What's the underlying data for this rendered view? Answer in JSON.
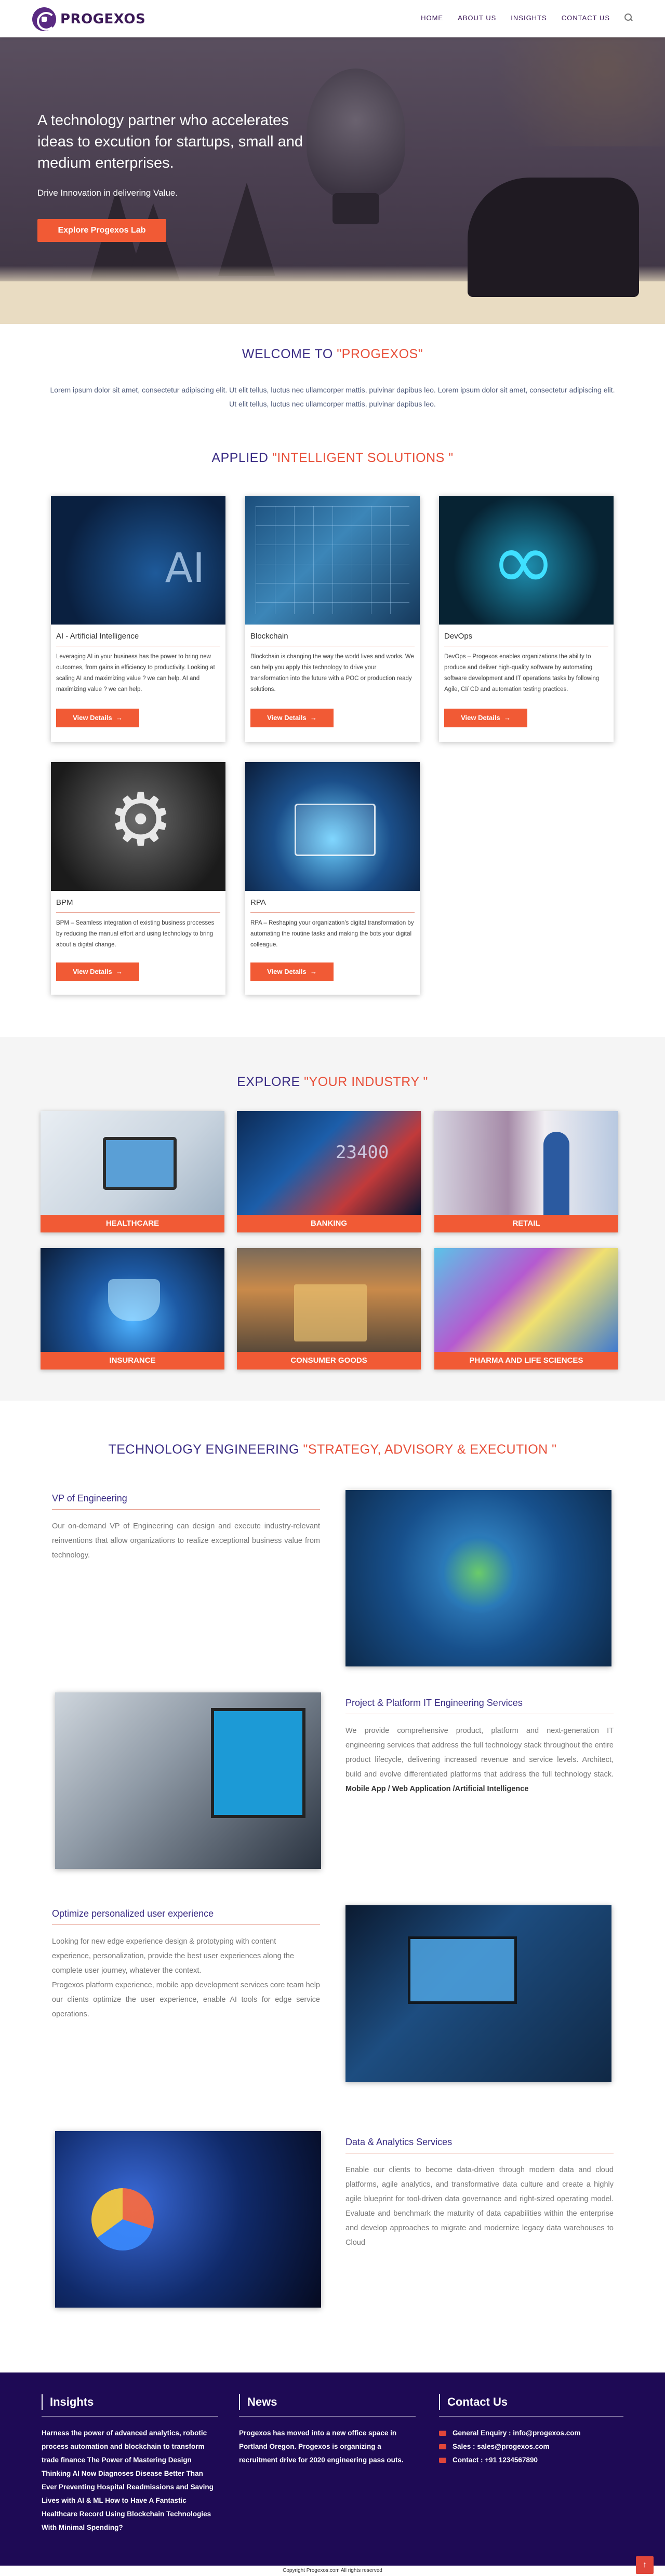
{
  "header": {
    "logo_text": "PROGEXOS",
    "nav": [
      "HOME",
      "ABOUT US",
      "INSIGHTS",
      "CONTACT US"
    ]
  },
  "hero": {
    "title": "A technology partner who accelerates ideas to excution for startups, small and medium enterprises.",
    "subtitle": "Drive Innovation in delivering Value.",
    "button": "Explore Progexos Lab"
  },
  "welcome": {
    "title": "WELCOME TO ",
    "title_hl": "\"PROGEXOS\"",
    "text": "Lorem ipsum dolor sit amet, consectetur adipiscing elit. Ut elit tellus, luctus nec ullamcorper mattis, pulvinar dapibus leo. Lorem ipsum dolor sit amet, consectetur adipiscing elit. Ut elit tellus, luctus nec ullamcorper mattis, pulvinar dapibus leo."
  },
  "solutions": {
    "title": "APPLIED ",
    "title_hl": "\"INTELLIGENT SOLUTIONS \"",
    "cards": [
      {
        "title": "AI - Artificial Intelligence",
        "desc": "Leveraging AI in your business has the power to bring new outcomes, from gains in efficiency to productivity. Looking at scaling AI and maximizing value ? we can help. AI and maximizing value ? we can help.",
        "button": "View Details"
      },
      {
        "title": "Blockchain",
        "desc": "Blockchain is changing the way the world lives and works. We can help you apply this technology to drive your transformation into the future with a POC or production ready solutions.",
        "button": "View Details"
      },
      {
        "title": "DevOps",
        "desc": "DevOps – Progexos enables organizations the ability to produce and deliver high-quality software by automating software development and IT operations tasks by following Agile, CI/ CD and automation testing practices.",
        "button": "View Details"
      },
      {
        "title": "BPM",
        "desc": "BPM – Seamless integration of existing business processes by reducing the manual effort and using technology to bring about a digital change.",
        "button": "View Details"
      },
      {
        "title": "RPA",
        "desc": "RPA – Reshaping your organization's digital transformation by automating the routine tasks and making the bots your digital colleague.",
        "button": "View Details"
      }
    ]
  },
  "industry": {
    "title": "EXPLORE ",
    "title_hl": "\"YOUR INDUSTRY \"",
    "items": [
      "HEALTHCARE",
      "BANKING",
      "RETAIL",
      "INSURANCE",
      "CONSUMER GOODS",
      "PHARMA AND LIFE SCIENCES"
    ]
  },
  "engineering": {
    "title": "TECHNOLOGY ENGINEERING ",
    "title_hl": "\"STRATEGY, ADVISORY & EXECUTION \"",
    "blocks": [
      {
        "title": "VP of Engineering",
        "text": "Our on-demand VP of Engineering can design and execute industry-relevant reinventions that allow organizations to realize exceptional business value from technology."
      },
      {
        "title": "Project & Platform IT Engineering Services",
        "text": "We provide comprehensive product, platform and next-generation IT engineering services that address the full technology stack throughout the entire product lifecycle, delivering increased revenue and service levels. Architect, build and evolve differentiated platforms that address the full technology stack.",
        "text_bold": "Mobile App / Web Application /Artificial Intelligence"
      },
      {
        "title": "Optimize personalized user experience",
        "lines": [
          "Looking for new edge experience design & prototyping with content",
          "experience, personalization, provide the best user experiences along the",
          "complete user journey, whatever the context.",
          "Progexos platform experience, mobile app development services core team help our clients optimize the user experience, enable AI tools for edge service operations."
        ]
      },
      {
        "title": "Data & Analytics Services",
        "text": "Enable our clients to become data-driven through modern data and cloud platforms, agile analytics, and transformative data culture and create a highly agile blueprint for tool-driven data governance and right-sized operating model. Evaluate and benchmark the maturity of data capabilities within the enterprise and develop approaches to migrate and modernize legacy data warehouses to Cloud"
      }
    ]
  },
  "footer": {
    "insights_title": "Insights",
    "insights_text": "Harness the power of advanced analytics, robotic process automation and blockchain to transform trade finance The Power of Mastering Design Thinking AI Now Diagnoses Disease Better Than Ever Preventing Hospital Readmissions and Saving Lives with AI & ML How to Have A Fantastic Healthcare Record Using Blockchain Technologies With Minimal Spending?",
    "news_title": "News",
    "news_text": "Progexos has moved into a new office space in Portland Oregon. Progexos is organizing a recruitment drive for 2020 engineering pass outs.",
    "contact_title": "Contact Us",
    "contact": [
      "General Enquiry : info@progexos.com",
      "Sales : sales@progexos.com",
      "Contact : +91 1234567890"
    ],
    "copyright": "Copyright Progexos.com All rights reserved",
    "to_top": "↑"
  }
}
